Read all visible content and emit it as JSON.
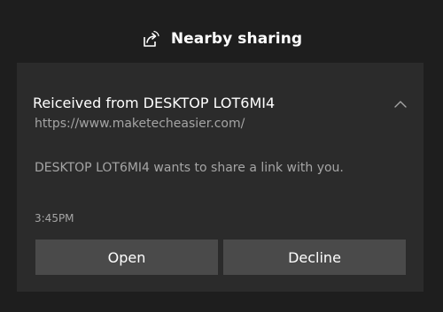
{
  "header": {
    "app_name": "Nearby sharing",
    "icon": "nearby-share-icon"
  },
  "notification": {
    "title": "Reiceived from DESKTOP LOT6MI4",
    "url": "https://www.maketecheasier.com/",
    "message": "DESKTOP LOT6MI4 wants to share a link with you.",
    "time": "3:45PM",
    "collapse_icon": "chevron-up-icon",
    "buttons": {
      "open": "Open",
      "decline": "Decline"
    }
  },
  "colors": {
    "background": "#1e1e1e",
    "toast_background": "#2b2b2b",
    "button_background": "#4a4a4a",
    "primary_text": "#ffffff",
    "secondary_text": "#a5a5a5"
  }
}
